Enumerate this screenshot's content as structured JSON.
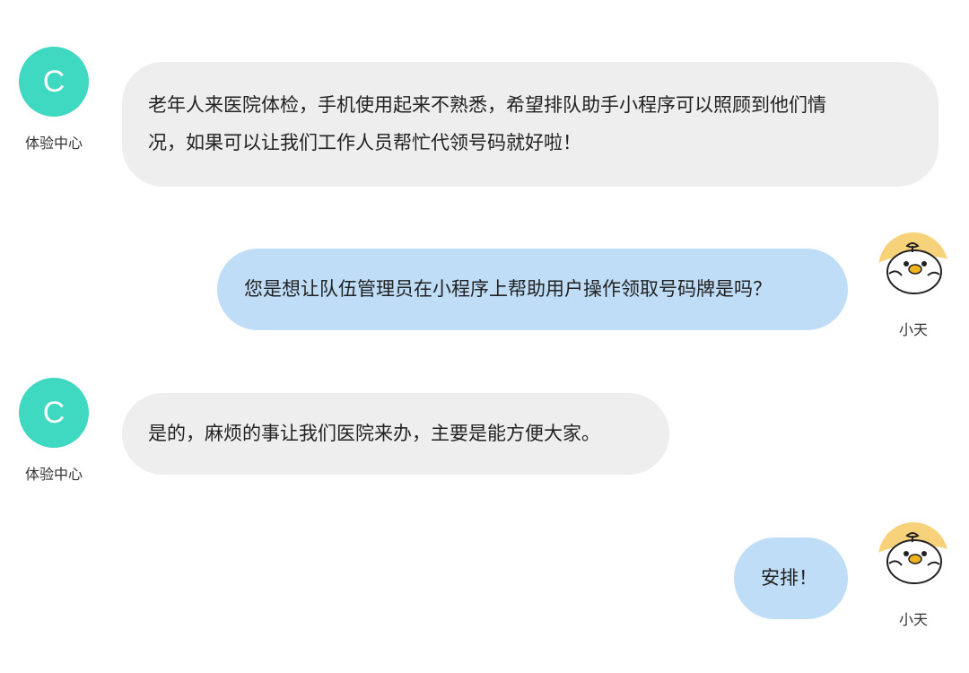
{
  "messages": [
    {
      "side": "left",
      "avatar_letter": "C",
      "sender": "体验中心",
      "lines": [
        "老年人来医院体检，手机使用起来不熟悉，希望排队助手小程序可以照顾到他们情",
        "况，如果可以让我们工作人员帮忙代领号码就好啦！"
      ]
    },
    {
      "side": "right",
      "avatar_icon": "duck-avatar-icon",
      "sender": "小天",
      "lines": [
        "您是想让队伍管理员在小程序上帮助用户操作领取号码牌是吗？"
      ]
    },
    {
      "side": "left",
      "avatar_letter": "C",
      "sender": "体验中心",
      "lines": [
        "是的，麻烦的事让我们医院来办，主要是能方便大家。"
      ]
    },
    {
      "side": "right",
      "avatar_icon": "duck-avatar-icon",
      "sender": "小天",
      "lines": [
        "安排！"
      ]
    }
  ],
  "colors": {
    "left_bubble": "#eeeeee",
    "right_bubble": "#bfddf7",
    "avatar_c": "#3fd8c0"
  }
}
